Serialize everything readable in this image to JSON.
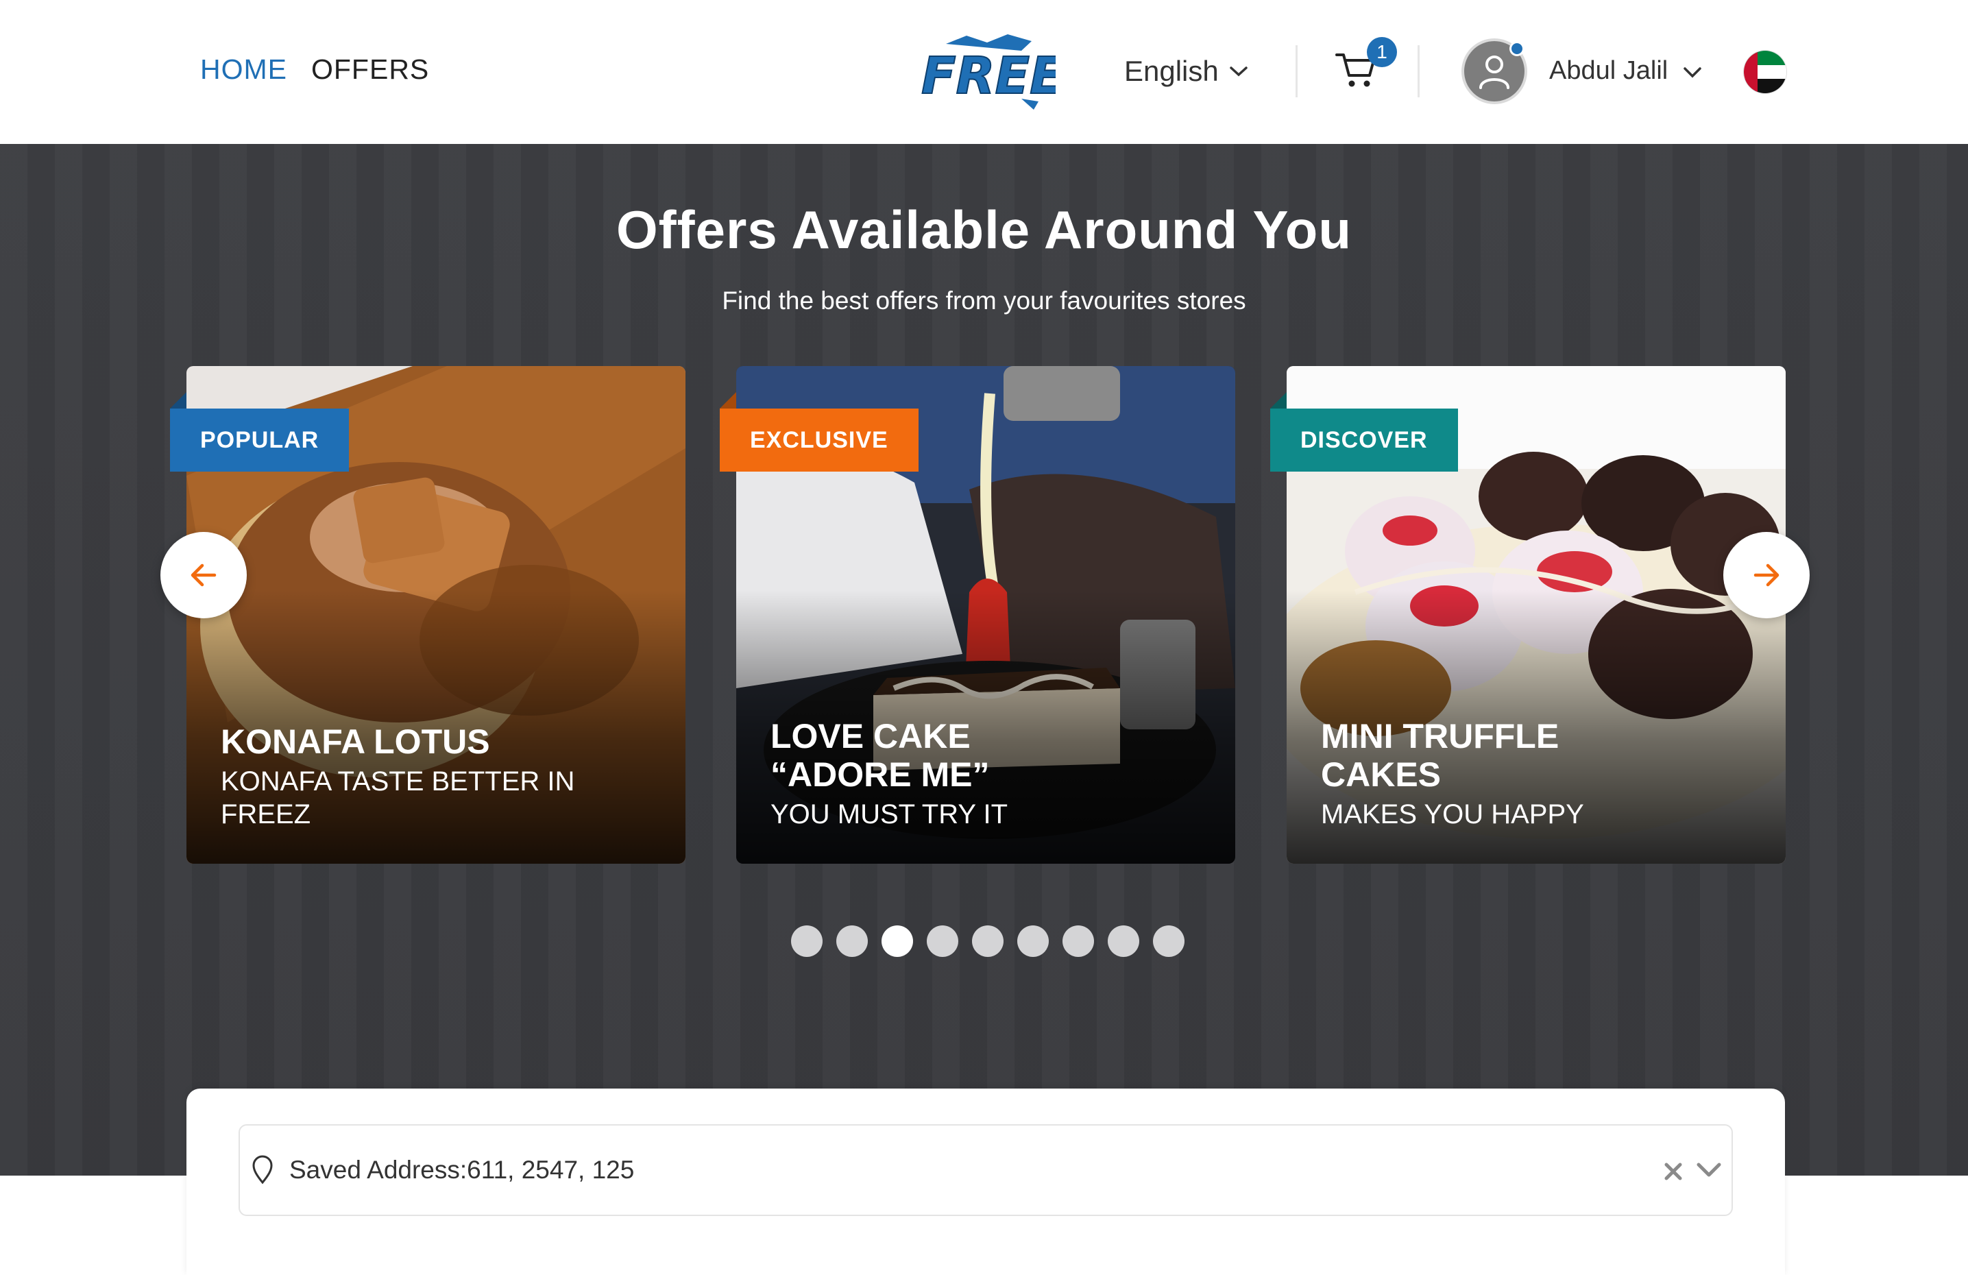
{
  "header": {
    "nav": [
      {
        "label": "HOME",
        "active": true
      },
      {
        "label": "OFFERS",
        "active": false
      }
    ],
    "logo_text": "FREEZ",
    "language": "English",
    "cart_count": "1",
    "user_name": "Abdul Jalil",
    "flag": "uae-flag-icon"
  },
  "hero": {
    "title": "Offers Available Around You",
    "subtitle": "Find the best offers from your favourites stores"
  },
  "cards": [
    {
      "badge": "POPULAR",
      "title": "KONAFA LOTUS",
      "desc": "KONAFA TASTE BETTER IN FREEZ",
      "badge_color": "#1f6fb5"
    },
    {
      "badge": "EXCLUSIVE",
      "title": "LOVE CAKE “ADORE ME”",
      "desc": "YOU MUST TRY IT",
      "badge_color": "#f26b0f"
    },
    {
      "badge": "DISCOVER",
      "title": "MINI TRUFFLE CAKES",
      "desc": "MAKES YOU HAPPY",
      "badge_color": "#0f8a8a"
    }
  ],
  "carousel": {
    "total_slides": 9,
    "active_index": 2
  },
  "address": {
    "value": "Saved Address:611, 2547, 125"
  },
  "colors": {
    "primary": "#1f6fb5",
    "accent": "#f26b0f",
    "hero_bg": "#3b3c40"
  }
}
